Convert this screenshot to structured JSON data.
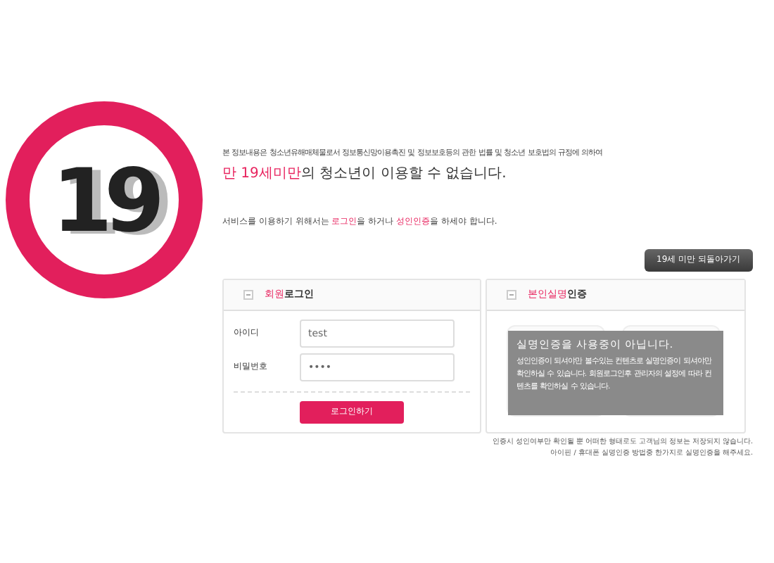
{
  "age_badge": "19",
  "notice": {
    "intro": "본 정보내용은 청소년유해매체물로서 정보통신망이용촉진 및 정보보호등의 관한 법률 및 청소년 보호법의 규정에 의하여",
    "headline": "**만 19세미만**의 청소년이 이용할 수 없습니다.",
    "instruction": "서비스를 이용하기 위해서는 **로그인**을 하거나 **성인인증**을 하세야 합니다."
  },
  "back_button": "19세 미만 되돌아가기",
  "login_panel": {
    "title": "**회원**로그인",
    "fields": [
      {
        "label": "아이디",
        "value": "test"
      },
      {
        "label": "비밀번호",
        "value": "••••"
      }
    ],
    "submit": "로그인하기"
  },
  "verify_panel": {
    "title": "**본인실명**인증",
    "overlay_title": "실명인증을 사용중이 아닙니다.",
    "overlay_message": "성인인증이 되셔야만 볼수있는 컨텐츠로 실명인증이 되셔야만 확인하실 수 있습니다. 회원로그인후 관리자의 설정에 따라 컨텐츠를 확인하실 수 있습니다."
  },
  "footer_notes": [
    "인증시 성인여부만 확인될 뿐 어떠한 형태로도 고객님의 정보는 저장되지 않습니다.",
    "아이핀 / 휴대폰 실명인증 방법중 한가지로 실명인증을 해주세요."
  ]
}
